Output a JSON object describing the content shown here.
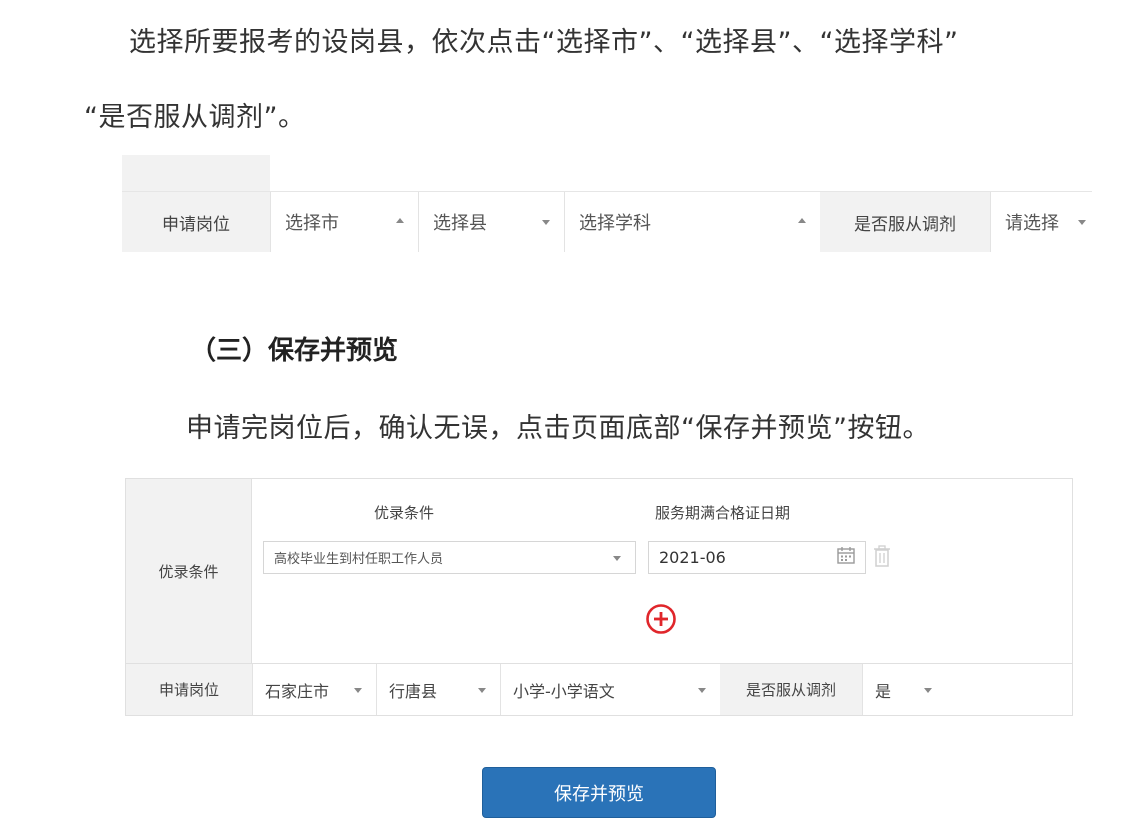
{
  "intro": {
    "line1": "选择所要报考的设岗县，依次点击“选择市”、“选择县”、“选择学科”",
    "line2": "“是否服从调剂”。"
  },
  "form1": {
    "label_position": "申请岗位",
    "city_placeholder": "选择市",
    "county_placeholder": "选择县",
    "subject_placeholder": "选择学科",
    "label_obey": "是否服从调剂",
    "obey_placeholder": "请选择"
  },
  "section3": {
    "heading": "（三）保存并预览",
    "paragraph": "申请完岗位后，确认无误，点击页面底部“保存并预览”按钮。"
  },
  "form2": {
    "label_priority": "优录条件",
    "col_priority": "优录条件",
    "col_service_date": "服务期满合格证日期",
    "priority_value": "高校毕业生到村任职工作人员",
    "date_value": "2021-06",
    "label_position": "申请岗位",
    "city_value": "石家庄市",
    "county_value": "行唐县",
    "subject_value": "小学-小学语文",
    "label_obey": "是否服从调剂",
    "obey_value": "是"
  },
  "save_button": {
    "label": "保存并预览"
  },
  "icons": {
    "calendar": "calendar-icon",
    "trash": "trash-icon",
    "add": "add-circle-icon"
  },
  "colors": {
    "primary_button": "#2a73b8",
    "add_icon": "#e0262b",
    "label_bg": "#f2f2f2"
  }
}
